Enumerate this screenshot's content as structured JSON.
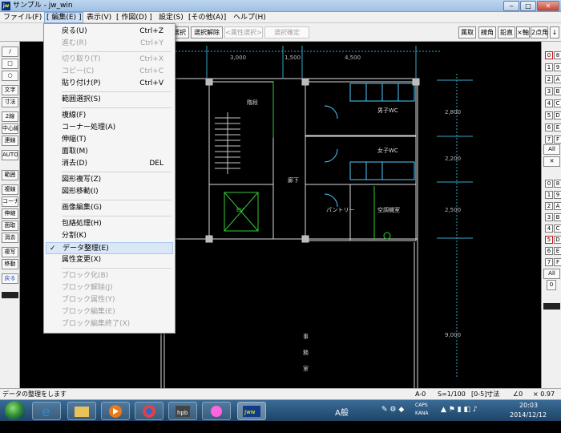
{
  "window": {
    "title": "サンプル - jw_win",
    "icon": "jw-app-icon",
    "controls": [
      "‒",
      "□",
      "✕"
    ]
  },
  "menubar": {
    "items": [
      "ファイル(F)",
      "[ 編集(E) ]",
      "表示(V)",
      "[ 作図(D) ]",
      "設定(S)",
      "[その他(A)]",
      "ヘルプ(H)"
    ],
    "active_index": 1
  },
  "toolbar": {
    "select": "選択",
    "deselect": "選択解除",
    "attr_select": "<属性選択>",
    "select_confirm": "選択確定",
    "r_buttons": [
      "属取",
      "線角",
      "鉛直",
      "×軸",
      "2点角",
      "↓"
    ]
  },
  "left_toolbar": [
    "/",
    "□",
    "○",
    "文字",
    "寸法",
    "2線",
    "中心線",
    "連線",
    "AUTO",
    "範囲",
    "複線",
    "コーナー",
    "伸縮",
    "面取",
    "消去",
    "複写",
    "移動",
    "戻る"
  ],
  "right_toolbar": {
    "layer_numbers": [
      "0",
      "1",
      "2",
      "3",
      "4",
      "5",
      "6",
      "7"
    ],
    "layer_letters": [
      "8",
      "9",
      "A",
      "B",
      "C",
      "D",
      "E",
      "F"
    ],
    "all": "All",
    "group_numbers": [
      "0",
      "1",
      "2",
      "3",
      "4",
      "5",
      "6",
      "7"
    ],
    "group_letters": [
      "8",
      "9",
      "A",
      "B",
      "C",
      "D",
      "E",
      "F"
    ],
    "group_all": "All",
    "group_zero": "0"
  },
  "edit_menu": {
    "sections": [
      [
        {
          "label": "戻る(U)",
          "shortcut": "Ctrl+Z",
          "enabled": true
        },
        {
          "label": "進む(R)",
          "shortcut": "Ctrl+Y",
          "enabled": false
        }
      ],
      [
        {
          "label": "切り取り(T)",
          "shortcut": "Ctrl+X",
          "enabled": false
        },
        {
          "label": "コピー(C)",
          "shortcut": "Ctrl+C",
          "enabled": false
        },
        {
          "label": "貼り付け(P)",
          "shortcut": "Ctrl+V",
          "enabled": true
        }
      ],
      [
        {
          "label": "範囲選択(S)",
          "shortcut": "",
          "enabled": true
        }
      ],
      [
        {
          "label": "複線(F)",
          "shortcut": "",
          "enabled": true
        },
        {
          "label": "コーナー処理(A)",
          "shortcut": "",
          "enabled": true
        },
        {
          "label": "伸縮(T)",
          "shortcut": "",
          "enabled": true
        },
        {
          "label": "面取(M)",
          "shortcut": "",
          "enabled": true
        },
        {
          "label": "消去(D)",
          "shortcut": "DEL",
          "enabled": true
        }
      ],
      [
        {
          "label": "図形複写(Z)",
          "shortcut": "",
          "enabled": true
        },
        {
          "label": "図形移動(I)",
          "shortcut": "",
          "enabled": true
        }
      ],
      [
        {
          "label": "画像編集(G)",
          "shortcut": "",
          "enabled": true
        }
      ],
      [
        {
          "label": "包絡処理(H)",
          "shortcut": "",
          "enabled": true
        },
        {
          "label": "分割(K)",
          "shortcut": "",
          "enabled": true
        },
        {
          "label": "データ整理(E)",
          "shortcut": "",
          "enabled": true,
          "checked": true,
          "highlighted": true
        },
        {
          "label": "属性変更(X)",
          "shortcut": "",
          "enabled": true
        }
      ],
      [
        {
          "label": "ブロック化(B)",
          "shortcut": "",
          "enabled": false
        },
        {
          "label": "ブロック解除(J)",
          "shortcut": "",
          "enabled": false
        },
        {
          "label": "ブロック属性(Y)",
          "shortcut": "",
          "enabled": false
        },
        {
          "label": "ブロック編集(E)",
          "shortcut": "",
          "enabled": false
        },
        {
          "label": "ブロック編集終了(X)",
          "shortcut": "",
          "enabled": false
        }
      ]
    ]
  },
  "drawing": {
    "dims_top": [
      "3,000",
      "1,500",
      "4,500"
    ],
    "dims_right": [
      "2,800",
      "2,200",
      "2,500",
      "9,000"
    ],
    "rooms": {
      "stair": "階段",
      "toilet_m": "男子WC",
      "toilet_f": "女子WC",
      "ev": "EV",
      "pantry": "パントリー",
      "shaft": "空調機室",
      "corridor": "廊下",
      "hall_1": "事",
      "hall_2": "務",
      "hall_3": "室"
    }
  },
  "status": {
    "message": "データの整理をします",
    "layer": "A-0",
    "scale": "S=1/100",
    "layer_state": "[0-5]寸法",
    "angle": "∠0",
    "zoom": "× 0.97"
  },
  "taskbar": {
    "ime_lang": "A般",
    "tray_labels": [
      "CAPS",
      "KANA"
    ],
    "time": "20:03",
    "date": "2014/12/12"
  }
}
